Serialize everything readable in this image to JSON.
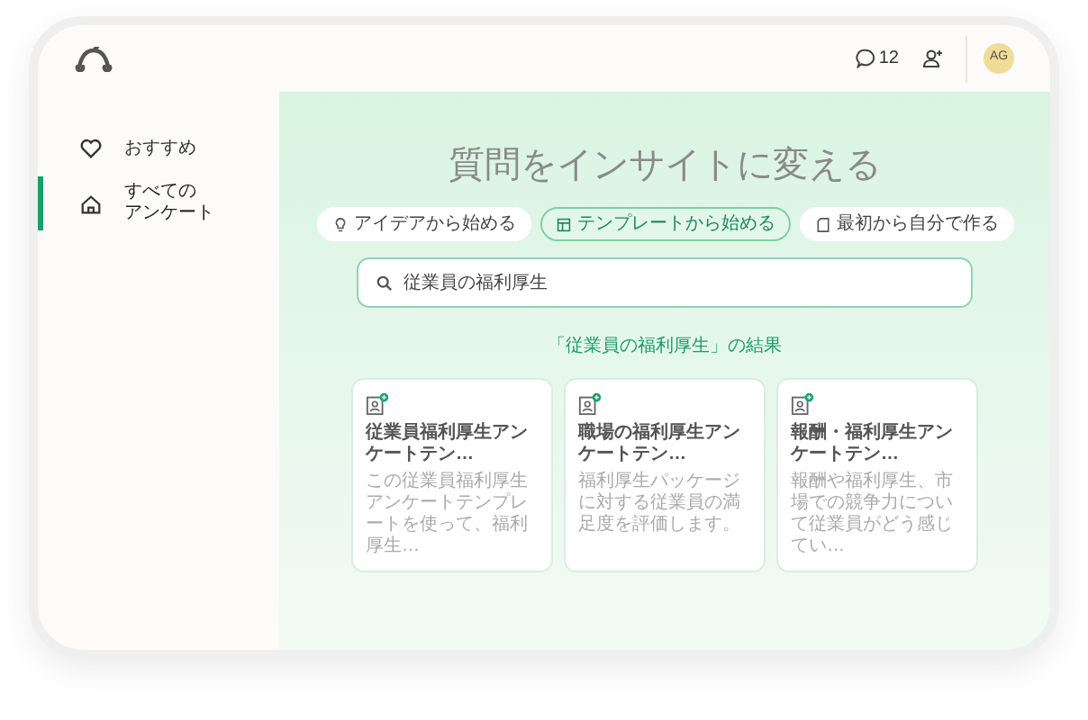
{
  "header": {
    "comment_count": "12",
    "avatar": "AG"
  },
  "sidebar": {
    "items": [
      {
        "label_lines": [
          "おすすめ"
        ],
        "selected": false
      },
      {
        "label_lines": [
          "すべての",
          "アンケート"
        ],
        "selected": true
      }
    ]
  },
  "main": {
    "title": "質問をインサイトに変える",
    "modes": [
      {
        "label": "アイデアから始める",
        "selected": false
      },
      {
        "label": "テンプレートから始める",
        "selected": true
      },
      {
        "label": "最初から自分で作る",
        "selected": false
      }
    ],
    "search": {
      "value": "従業員の福利厚生"
    },
    "results_caption": "「従業員の福利厚生」の結果",
    "cards": [
      {
        "title": "従業員福利厚生アンケートテン…",
        "description": "この従業員福利厚生アンケートテンプレートを使って、福利厚生…"
      },
      {
        "title": "職場の福利厚生アンケートテン…",
        "description": "福利厚生パッケージに対する従業員の満足度を評価します。"
      },
      {
        "title": "報酬・福利厚生アンケートテン…",
        "description": "報酬や福利厚生、市場での競争力について従業員がどう感じてい…"
      }
    ]
  }
}
